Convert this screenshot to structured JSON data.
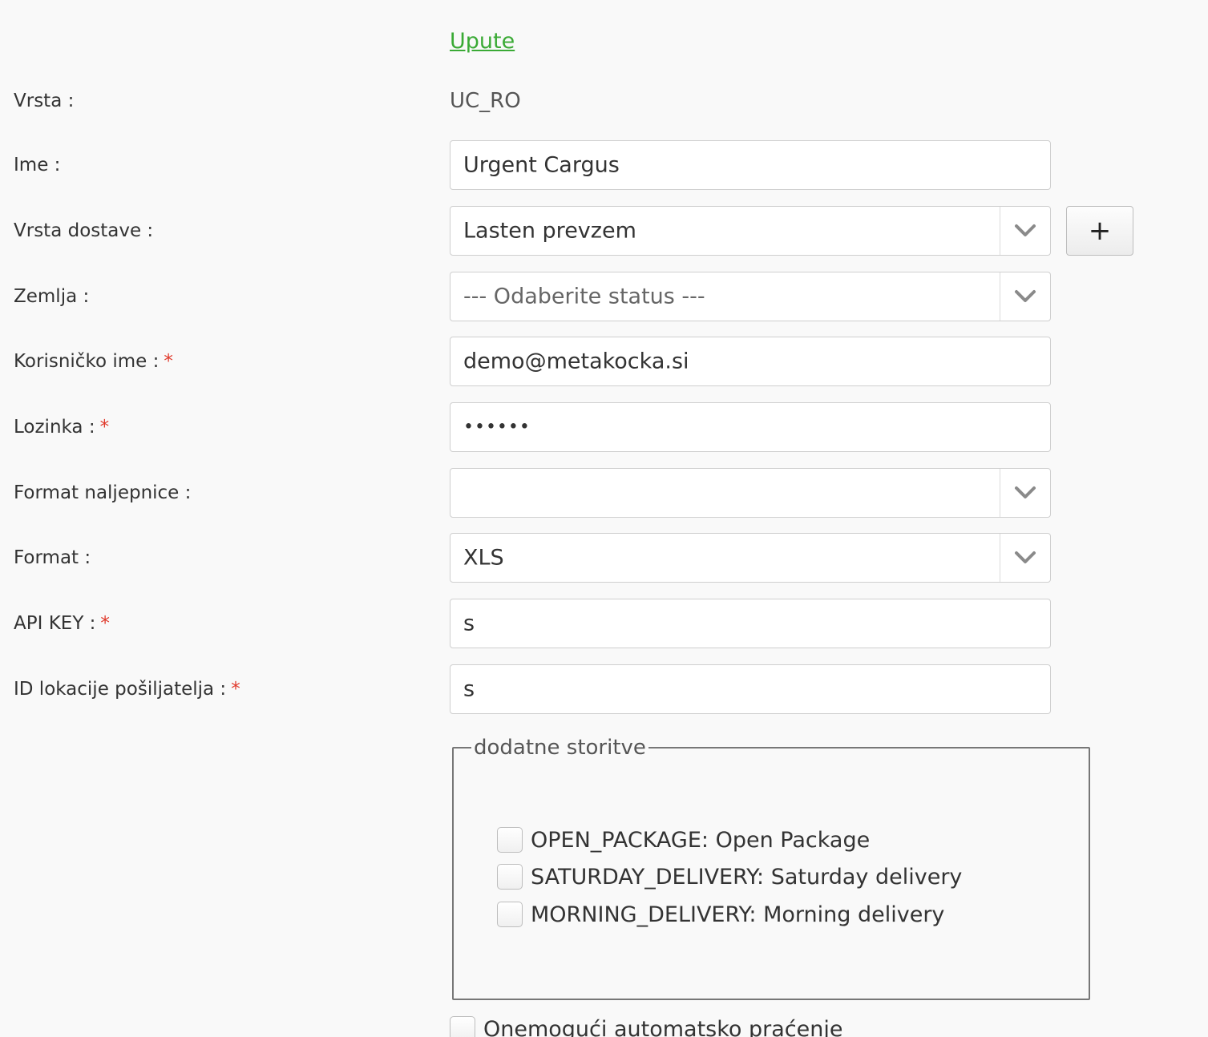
{
  "upute_link": "Upute",
  "fields": {
    "vrsta": {
      "label": "Vrsta :",
      "value": "UC_RO"
    },
    "ime": {
      "label": "Ime :",
      "value": "Urgent Cargus"
    },
    "vrsta_dostave": {
      "label": "Vrsta dostave :",
      "value": "Lasten prevzem",
      "add_label": "+"
    },
    "zemlja": {
      "label": "Zemlja :",
      "placeholder": "--- Odaberite status ---"
    },
    "korisnicko_ime": {
      "label": "Korisničko ime :",
      "required": "*",
      "value": "demo@metakocka.si"
    },
    "lozinka": {
      "label": "Lozinka :",
      "required": "*",
      "value": "••••••"
    },
    "format_naljepnice": {
      "label": "Format naljepnice :",
      "value": ""
    },
    "format": {
      "label": "Format :",
      "value": "XLS"
    },
    "api_key": {
      "label": "API KEY :",
      "required": "*",
      "value": "s"
    },
    "id_lokacije": {
      "label": "ID lokacije pošiljatelja :",
      "required": "*",
      "value": "s"
    }
  },
  "services": {
    "legend": "dodatne storitve",
    "options": [
      {
        "label": "OPEN_PACKAGE: Open Package",
        "checked": false
      },
      {
        "label": "SATURDAY_DELIVERY: Saturday delivery",
        "checked": false
      },
      {
        "label": "MORNING_DELIVERY: Morning delivery",
        "checked": false
      }
    ]
  },
  "disable_tracking": {
    "label": "Onemogući automatsko praćenje",
    "checked": false
  },
  "colors": {
    "link": "#3aaa35",
    "required": "#e0392b",
    "background": "#f9f9f9"
  },
  "icons": {
    "select_arrow": "chevron-down-icon",
    "add": "plus-icon"
  }
}
